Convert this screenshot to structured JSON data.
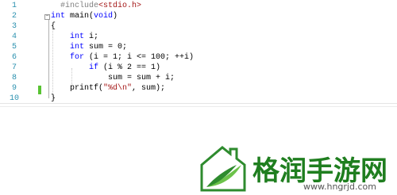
{
  "editor": {
    "line_numbers": [
      "1",
      "2",
      "3",
      "4",
      "5",
      "6",
      "7",
      "8",
      "9",
      "10"
    ],
    "lines": [
      {
        "segments": [
          {
            "t": "#include",
            "c": "pp"
          },
          {
            "t": "<stdio.h>",
            "c": "inc"
          }
        ]
      },
      {
        "segments": [
          {
            "t": "int",
            "c": "kw"
          },
          {
            "t": " main(",
            "c": ""
          },
          {
            "t": "void",
            "c": "kw"
          },
          {
            "t": ")",
            "c": ""
          }
        ]
      },
      {
        "segments": [
          {
            "t": "{",
            "c": ""
          }
        ]
      },
      {
        "segments": [
          {
            "t": "    ",
            "c": ""
          },
          {
            "t": "int",
            "c": "kw"
          },
          {
            "t": " i;",
            "c": ""
          }
        ]
      },
      {
        "segments": [
          {
            "t": "    ",
            "c": ""
          },
          {
            "t": "int",
            "c": "kw"
          },
          {
            "t": " sum = 0;",
            "c": ""
          }
        ]
      },
      {
        "segments": [
          {
            "t": "    ",
            "c": ""
          },
          {
            "t": "for",
            "c": "kw"
          },
          {
            "t": " (i = 1; i <= 100; ++i)",
            "c": ""
          }
        ]
      },
      {
        "segments": [
          {
            "t": "        ",
            "c": ""
          },
          {
            "t": "if",
            "c": "kw"
          },
          {
            "t": " (i % 2 == 1)",
            "c": ""
          }
        ]
      },
      {
        "segments": [
          {
            "t": "            sum = sum + i;",
            "c": ""
          }
        ]
      },
      {
        "segments": [
          {
            "t": "    printf(",
            "c": ""
          },
          {
            "t": "\"%d\\n\"",
            "c": "str"
          },
          {
            "t": ", sum);",
            "c": ""
          }
        ]
      },
      {
        "segments": [
          {
            "t": "}",
            "c": ""
          }
        ]
      }
    ],
    "fold_marker": "−"
  },
  "watermark": {
    "brand_text": "格润手游网",
    "url": "www.hngrjd.com",
    "brand_color": "#1f7e1f"
  }
}
